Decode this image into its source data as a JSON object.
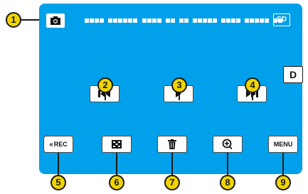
{
  "header": {
    "mode_icon": "camera-icon",
    "storage_label": "SD"
  },
  "side_button": {
    "label": "D"
  },
  "controls": {
    "rec_label": "REC",
    "rec_icon": "double-chevron-left-icon",
    "menu_label": "MENU",
    "buttons": [
      {
        "name": "skip-back",
        "icon": "skip-back-icon"
      },
      {
        "name": "play",
        "icon": "play-icon"
      },
      {
        "name": "skip-forward",
        "icon": "skip-forward-icon"
      },
      {
        "name": "index",
        "icon": "grid-icon"
      },
      {
        "name": "delete",
        "icon": "trash-icon"
      },
      {
        "name": "zoom",
        "icon": "zoom-in-icon"
      }
    ]
  },
  "callouts": [
    "1",
    "2",
    "3",
    "4",
    "5",
    "6",
    "7",
    "8",
    "9"
  ],
  "colors": {
    "screen": "#00a0ea",
    "callout_fill": "#f0d400",
    "button_fill": "#ffffff"
  }
}
